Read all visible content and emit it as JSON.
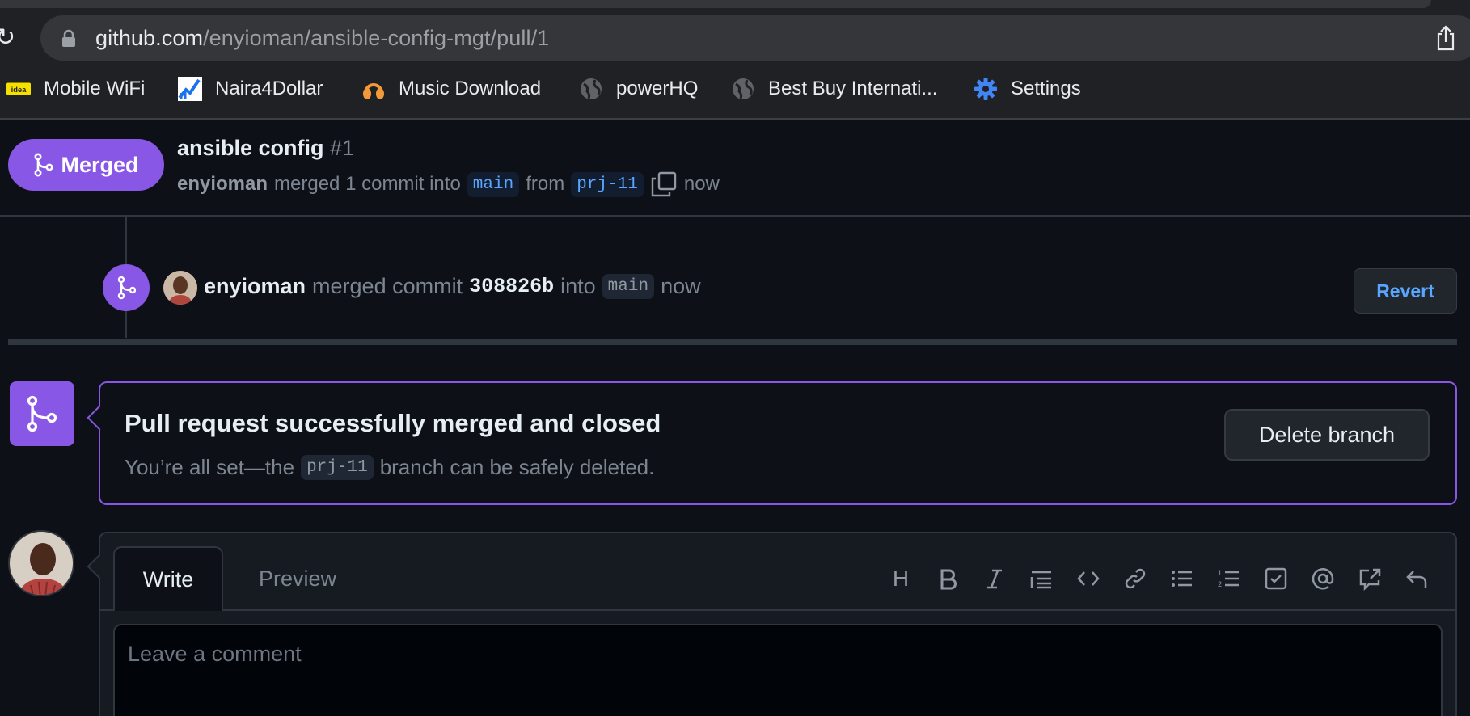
{
  "browser": {
    "url_host": "github.com",
    "url_path": "/enyioman/ansible-config-mgt/pull/1",
    "bookmarks": [
      {
        "label": "Mobile WiFi",
        "icon": "idea-badge-icon"
      },
      {
        "label": "Naira4Dollar",
        "icon": "chart-icon"
      },
      {
        "label": "Music Download",
        "icon": "headphones-icon"
      },
      {
        "label": "powerHQ",
        "icon": "globe-icon"
      },
      {
        "label": "Best Buy Internati...",
        "icon": "globe-icon"
      },
      {
        "label": "Settings",
        "icon": "gear-icon"
      }
    ],
    "bookmark_badge_text": "idea"
  },
  "pr": {
    "status": "Merged",
    "title": "ansible config",
    "number": "#1",
    "author": "enyioman",
    "merge_text": "merged 1 commit into",
    "base_branch": "main",
    "from_text": "from",
    "head_branch": "prj-11",
    "time": "now"
  },
  "timeline": {
    "user": "enyioman",
    "merged_text": "merged commit",
    "sha": "308826b",
    "into_text": "into",
    "branch": "main",
    "time": "now",
    "revert_label": "Revert"
  },
  "merge_box": {
    "title": "Pull request successfully merged and closed",
    "desc_before": "You’re all set—the",
    "branch": "prj-11",
    "desc_after": "branch can be safely deleted.",
    "delete_label": "Delete branch"
  },
  "comment": {
    "write_tab": "Write",
    "preview_tab": "Preview",
    "placeholder": "Leave a comment",
    "heading_glyph": "H",
    "toolbar": [
      "heading",
      "bold",
      "italic",
      "quote",
      "code",
      "link",
      "unordered-list",
      "ordered-list",
      "task-list",
      "mention",
      "reference",
      "undo"
    ]
  },
  "colors": {
    "merged_purple": "#8957e5",
    "link_blue": "#58a6ff",
    "bg": "#0d1117"
  }
}
